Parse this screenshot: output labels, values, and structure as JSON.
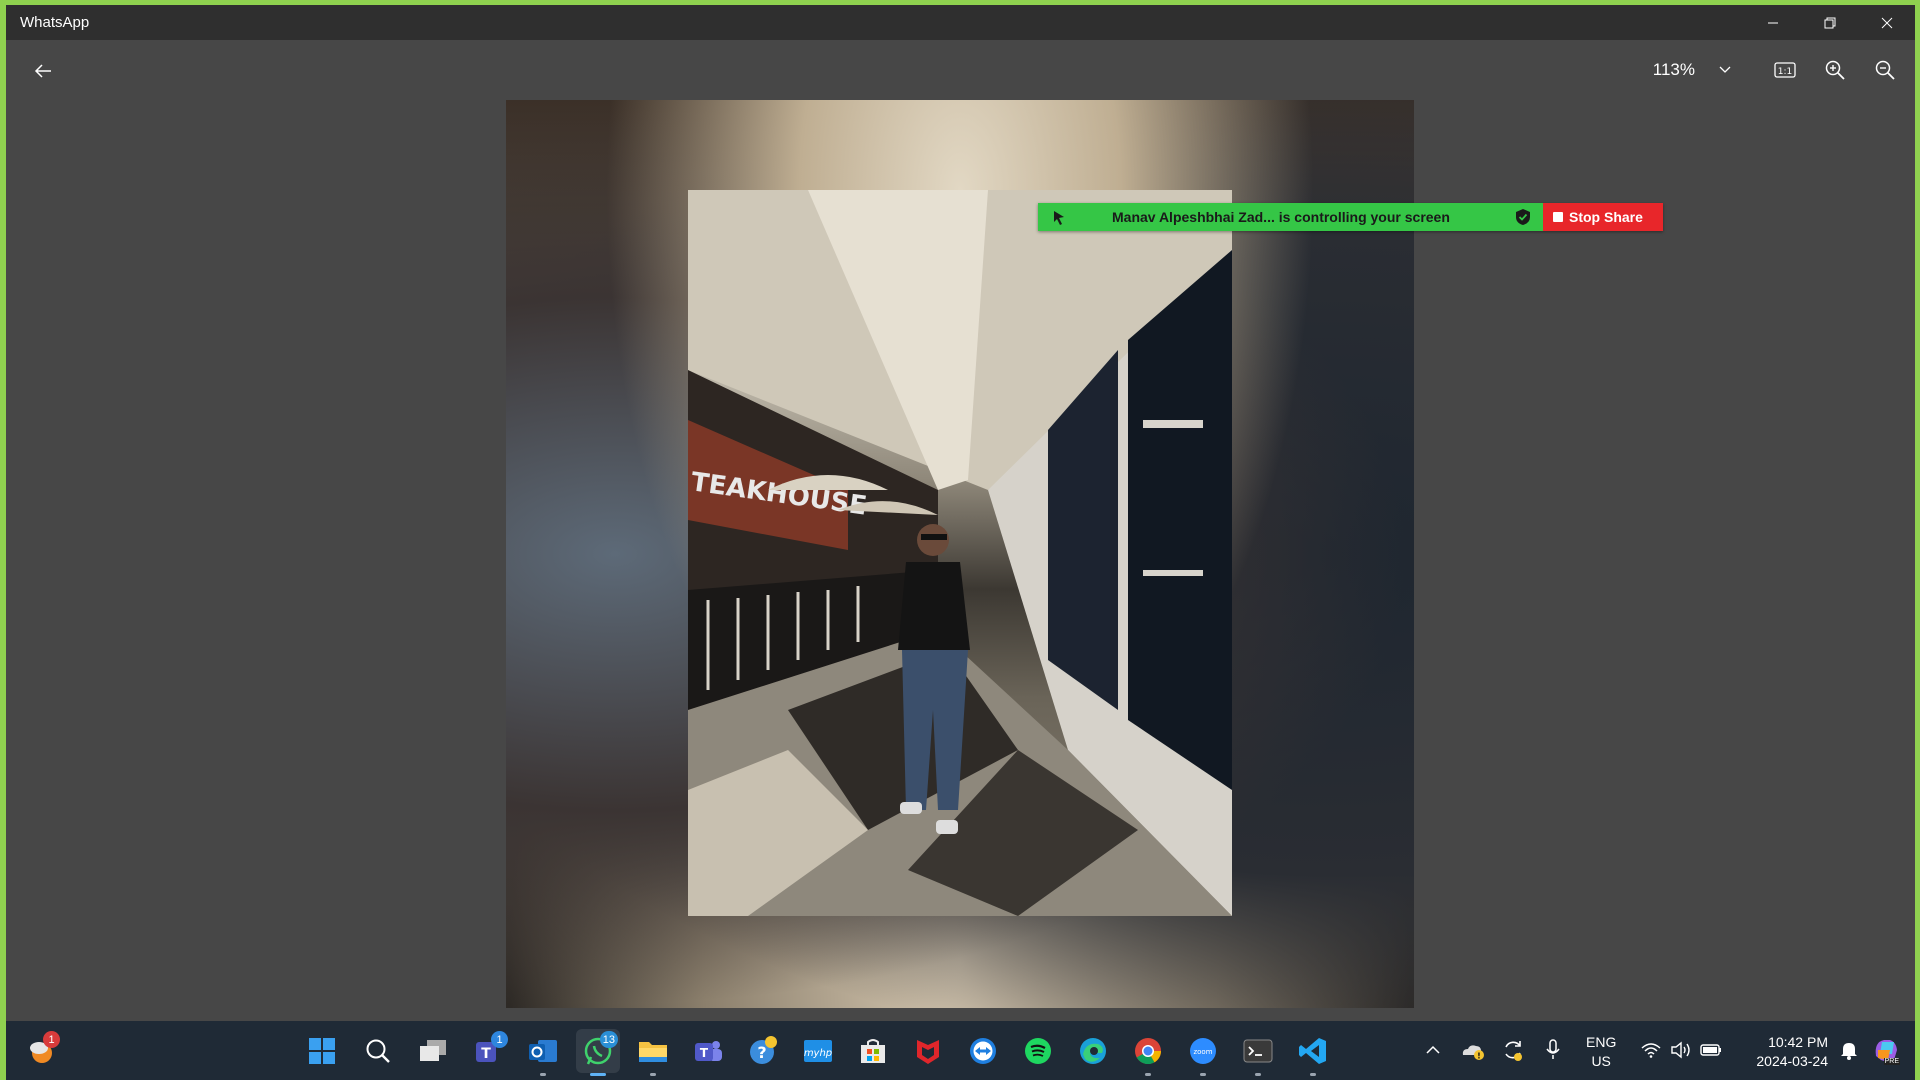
{
  "window": {
    "title": "WhatsApp"
  },
  "toolbar": {
    "zoom_level": "113%"
  },
  "share_banner": {
    "message": "Manav Alpeshbhai Zad... is controlling your screen",
    "stop_label": "Stop Share",
    "color_green": "#35c646",
    "color_red": "#e8262a"
  },
  "photo": {
    "sign_text": "TEAKHOUSE"
  },
  "taskbar": {
    "weather_badge": "1",
    "teams_badge": "1",
    "whatsapp_badge": "13",
    "language": "ENG",
    "region": "US",
    "time": "10:42 PM",
    "date": "2024-03-24",
    "copilot_label": "PRE"
  },
  "colors": {
    "accent_border": "#8fd14f",
    "taskbar_bg": "#1f2a36",
    "viewer_bg": "#474747"
  }
}
